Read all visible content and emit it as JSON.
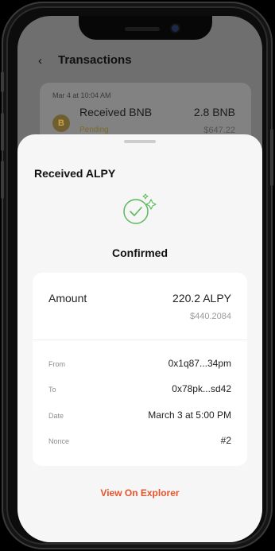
{
  "background_screen": {
    "header_title": "Transactions",
    "back_icon": "chevron-left-icon",
    "transaction": {
      "date": "Mar 4 at 10:04 AM",
      "name": "Received BNB",
      "status": "Pending",
      "amount": "2.8 BNB",
      "fiat": "$647.22",
      "coin_icon": "bnb-coin-icon"
    }
  },
  "sheet": {
    "title": "Received ALPY",
    "status_icon": "check-sparkle-icon",
    "status": "Confirmed",
    "amount": {
      "label": "Amount",
      "value": "220.2 ALPY",
      "fiat": "$440.2084"
    },
    "details": [
      {
        "label": "From",
        "value": "0x1q87...34pm"
      },
      {
        "label": "To",
        "value": "0x78pk...sd42"
      },
      {
        "label": "Date",
        "value": "March 3 at 5:00 PM"
      },
      {
        "label": "Nonce",
        "value": "#2"
      }
    ],
    "explorer_link": "View On Explorer"
  },
  "colors": {
    "accent": "#e8532c",
    "success": "#5cb85c",
    "pending": "#caa245"
  }
}
